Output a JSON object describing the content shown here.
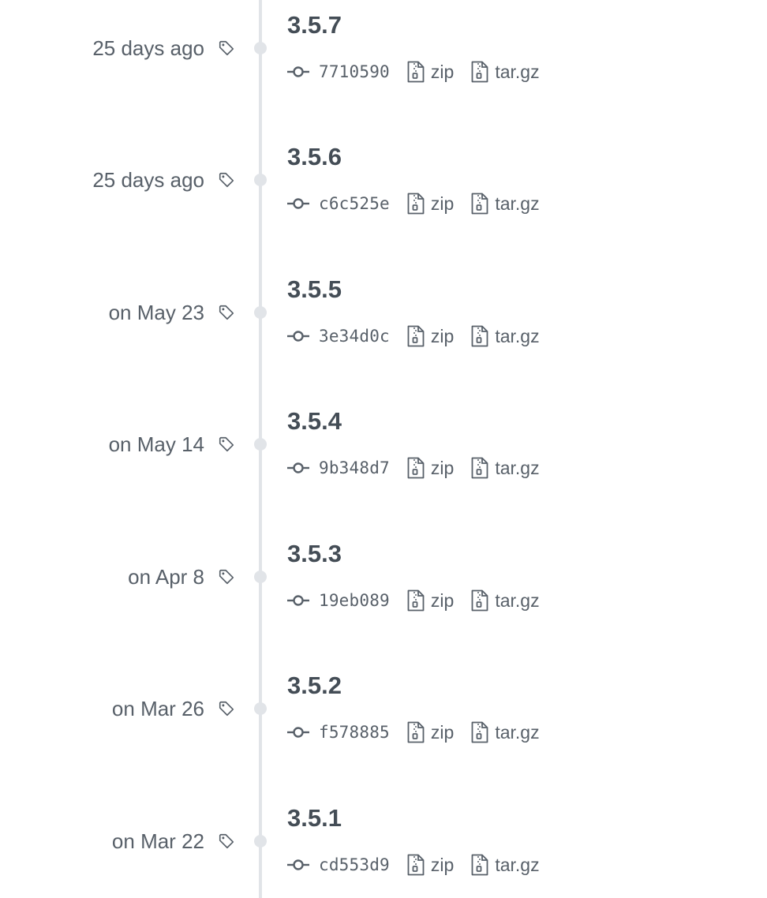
{
  "releases": [
    {
      "date": "25 days ago",
      "version": "3.5.7",
      "sha": "7710590",
      "zip_label": "zip",
      "tar_label": "tar.gz"
    },
    {
      "date": "25 days ago",
      "version": "3.5.6",
      "sha": "c6c525e",
      "zip_label": "zip",
      "tar_label": "tar.gz"
    },
    {
      "date": "on May 23",
      "version": "3.5.5",
      "sha": "3e34d0c",
      "zip_label": "zip",
      "tar_label": "tar.gz"
    },
    {
      "date": "on May 14",
      "version": "3.5.4",
      "sha": "9b348d7",
      "zip_label": "zip",
      "tar_label": "tar.gz"
    },
    {
      "date": "on Apr 8",
      "version": "3.5.3",
      "sha": "19eb089",
      "zip_label": "zip",
      "tar_label": "tar.gz"
    },
    {
      "date": "on Mar 26",
      "version": "3.5.2",
      "sha": "f578885",
      "zip_label": "zip",
      "tar_label": "tar.gz"
    },
    {
      "date": "on Mar 22",
      "version": "3.5.1",
      "sha": "cd553d9",
      "zip_label": "zip",
      "tar_label": "tar.gz"
    }
  ],
  "icons": {
    "tag": "tag-icon",
    "commit": "git-commit-icon",
    "archive": "file-zip-icon"
  },
  "colors": {
    "timeline": "#e1e4e8",
    "muted_text": "#586069",
    "version_text": "#444d56"
  }
}
